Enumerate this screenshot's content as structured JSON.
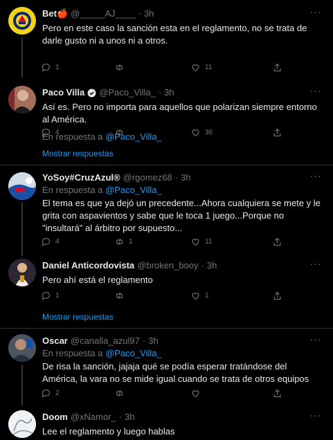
{
  "tweets": [
    {
      "name": "Bet🍎",
      "handle": "@_____AJ____",
      "dot": "·",
      "time": "3h",
      "reply_prefix": "",
      "reply_to": "",
      "text": "Pero en este caso la sanción esta en el reglamento, no se trata de darle gusto ni a unos ni a otros.",
      "replies": "1",
      "retweets": "",
      "likes": "11",
      "avatar": "america-crest"
    },
    {
      "name": "Paco Villa",
      "handle": "@Paco_Villa_",
      "dot": "·",
      "time": "3h",
      "verified": true,
      "text": "Así es. Pero no importa para aquellos que polarizan siempre entorno al América.",
      "replies": "4",
      "retweets": "",
      "likes": "36",
      "avatar": "person-photo"
    },
    {
      "name": "YoSoy#CruzAzul®",
      "handle": "@rgomez68",
      "dot": "·",
      "time": "3h",
      "reply_prefix": "En respuesta a",
      "reply_to": "@Paco_Villa_",
      "text": "El tema es que ya dejó un precedente...Ahora cualquiera se mete y le grita con aspavientos y sabe que le toca 1 juego...Porque no \"insultará\" al árbitro por supuesto...",
      "replies": "4",
      "retweets": "1",
      "likes": "11",
      "avatar": "cruz-azul-photo"
    },
    {
      "name": "Daniel Anticordovista",
      "handle": "@broken_booy",
      "dot": "·",
      "time": "3h",
      "text": "Pero ahí está el reglamento",
      "replies": "1",
      "retweets": "",
      "likes": "1",
      "avatar": "person-photo"
    },
    {
      "name": "Oscar",
      "handle": "@canalla_azul97",
      "dot": "·",
      "time": "3h",
      "reply_prefix": "En respuesta a",
      "reply_to": "@Paco_Villa_",
      "text": "De risa la sanción, jajaja qué se podía esperar tratándose del América, la vara no se mide igual cuando se trata de otros equipos",
      "replies": "2",
      "retweets": "",
      "likes": "",
      "avatar": "person-photo"
    },
    {
      "name": "Doom",
      "handle": "@xNamor_",
      "dot": "·",
      "time": "3h",
      "text": "Lee el reglamento y luego hablas",
      "avatar": "sketch-photo"
    }
  ],
  "reply_context": {
    "prefix": "En respuesta a",
    "handle": "@Paco_Villa_"
  },
  "show_replies_label": "Mostrar respuestas",
  "colors": {
    "background": "#000000",
    "text": "#e7e9ea",
    "muted": "#71767b",
    "link": "#1d9bf0",
    "separator": "#2f3336"
  }
}
